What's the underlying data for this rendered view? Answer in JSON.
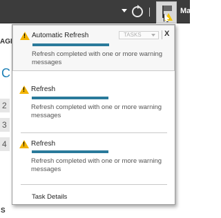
{
  "topbar": {
    "user_label": "Ma"
  },
  "background": {
    "section_label": "AGE",
    "blue_char": "C",
    "numbers": [
      "2",
      "3",
      "4"
    ],
    "bottom_letter": "S"
  },
  "popup": {
    "tasks_dropdown_label": "TASKS",
    "close_label": "X",
    "notifications": [
      {
        "title": "Automatic Refresh",
        "message": "Refresh completed with one or more warning messages"
      },
      {
        "title": "Refresh",
        "message": "Refresh completed with one or more warning messages"
      },
      {
        "title": "Refresh",
        "message": "Refresh completed with one or more warning messages"
      }
    ],
    "task_details_label": "Task Details"
  }
}
